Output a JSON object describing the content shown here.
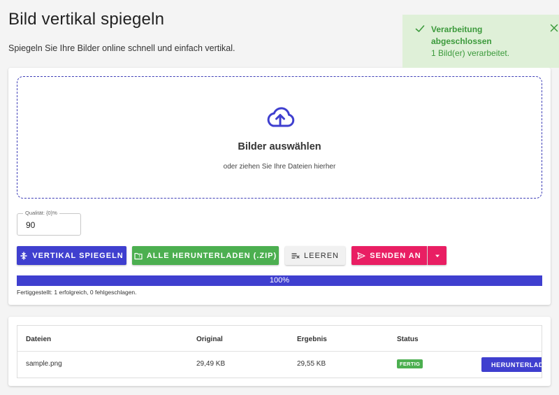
{
  "page": {
    "title": "Bild vertikal spiegeln",
    "subtitle": "Spiegeln Sie Ihre Bilder online schnell und einfach vertikal."
  },
  "toast": {
    "title": "Verarbeitung abgeschlossen",
    "message": "1 Bild(er) verarbeitet.",
    "icon": "check-icon",
    "close_icon": "close-icon",
    "color": "#3c9a3c",
    "background": "#dff0d8"
  },
  "dropzone": {
    "icon": "cloud-upload-icon",
    "title": "Bilder auswählen",
    "subtitle": "oder ziehen Sie Ihre Dateien hierher",
    "border_color": "#3f3fb7"
  },
  "quality": {
    "label": "Qualität: {0}%",
    "value": "90"
  },
  "toolbar": {
    "flip_label": "VERTIKAL SPIEGELN",
    "download_all_label": "ALLE HERUNTERLADEN (.ZIP)",
    "clear_label": "LEEREN",
    "send_label": "SENDEN AN"
  },
  "colors": {
    "primary": "#3f3fcf",
    "success": "#4caf50",
    "accent": "#e91e63"
  },
  "progress": {
    "value": 100,
    "label": "100%",
    "summary": "Fertiggestellt: 1 erfolgreich, 0 fehlgeschlagen."
  },
  "table": {
    "headers": [
      "Dateien",
      "Original",
      "Ergebnis",
      "Status"
    ],
    "rows": [
      {
        "file": "sample.png",
        "original": "29,49 KB",
        "result": "29,55 KB",
        "status": "FERTIG",
        "action": "HERUNTERLADEN"
      }
    ]
  }
}
